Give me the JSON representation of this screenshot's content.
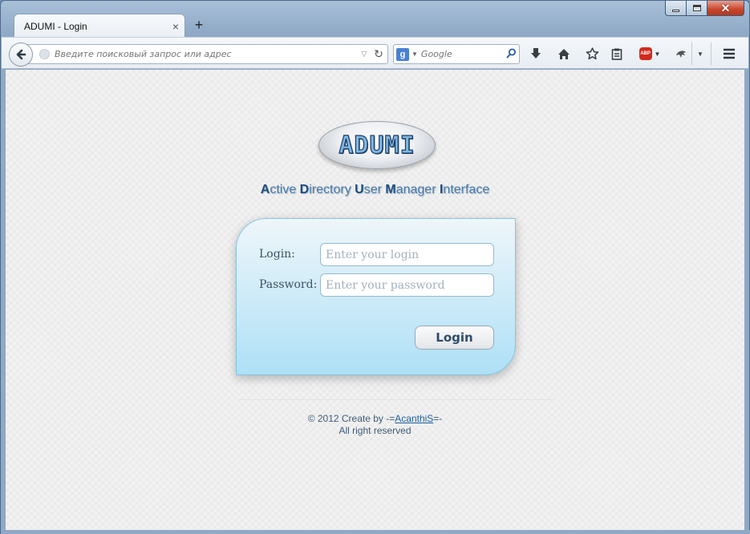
{
  "window": {
    "tab_title": "ADUMI - Login",
    "tab_close": "×",
    "new_tab": "+",
    "minimize_icon": "minimize-icon",
    "maximize_icon": "maximize-icon",
    "close_icon": "close-icon"
  },
  "toolbar": {
    "url_placeholder": "Введите поисковый запрос или адрес",
    "url_value": "",
    "search_engine": "g",
    "search_placeholder": "Google",
    "icons": [
      "back-icon",
      "reload-icon",
      "search-icon",
      "download-icon",
      "home-icon",
      "bookmark-star-icon",
      "reading-list-icon",
      "adblock-icon",
      "extension-icon",
      "menu-icon"
    ],
    "abp_label": "ABP"
  },
  "page": {
    "logo_text": "ADUMI",
    "tagline": [
      {
        "initial": "A",
        "rest": "ctive "
      },
      {
        "initial": "D",
        "rest": "irectory "
      },
      {
        "initial": "U",
        "rest": "ser "
      },
      {
        "initial": "M",
        "rest": "anager "
      },
      {
        "initial": "I",
        "rest": "nterface"
      }
    ],
    "form": {
      "login_label": "Login:",
      "login_placeholder": "Enter your login",
      "password_label": "Password:",
      "password_placeholder": "Enter your password",
      "submit_label": "Login"
    },
    "footer": {
      "line1_prefix": "© 2012 Create by -=",
      "author_link": "AcanthiS",
      "line1_suffix": "=-",
      "line2": "All right reserved"
    }
  },
  "colors": {
    "accent": "#1e4d7e",
    "login_box_top": "#eef6fa",
    "login_box_bottom": "#aee0f6",
    "link": "#1f5c9e"
  }
}
